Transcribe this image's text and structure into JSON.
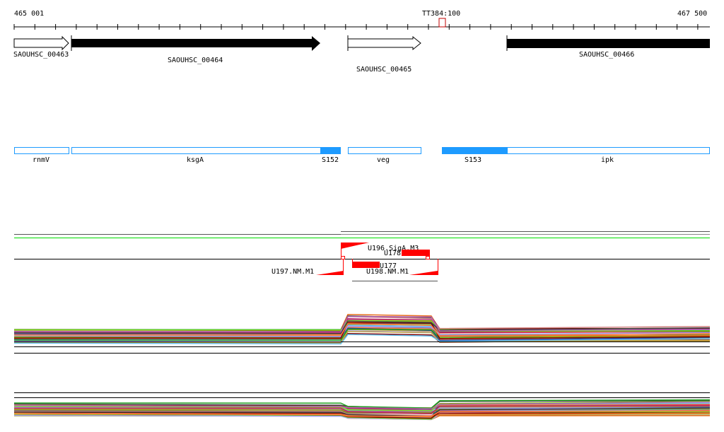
{
  "ruler": {
    "start_label": "465 001",
    "end_label": "467 500",
    "marker_label": "TT384:100"
  },
  "genes": [
    {
      "name": "SAOUHSC_00463",
      "strand": "+",
      "filled": false
    },
    {
      "name": "SAOUHSC_00464",
      "strand": "+",
      "filled": true
    },
    {
      "name": "SAOUHSC_00465",
      "strand": "+",
      "filled": false
    },
    {
      "name": "SAOUHSC_00466",
      "strand": "+",
      "filled": true
    }
  ],
  "annotations": [
    {
      "name": "rnmV"
    },
    {
      "name": "ksgA"
    },
    {
      "name": "S152"
    },
    {
      "name": "veg"
    },
    {
      "name": "S153"
    },
    {
      "name": "ipk"
    }
  ],
  "features": [
    {
      "name": "U196.SigA.M3"
    },
    {
      "name": "U178"
    },
    {
      "name": "U177"
    },
    {
      "name": "U197.NM.M1"
    },
    {
      "name": "U198.NM.M1"
    }
  ],
  "colors": {
    "accent_blue": "#1e9bff",
    "feature_red": "#ff0000",
    "green": "#00dd00",
    "marker": "#c00000"
  }
}
